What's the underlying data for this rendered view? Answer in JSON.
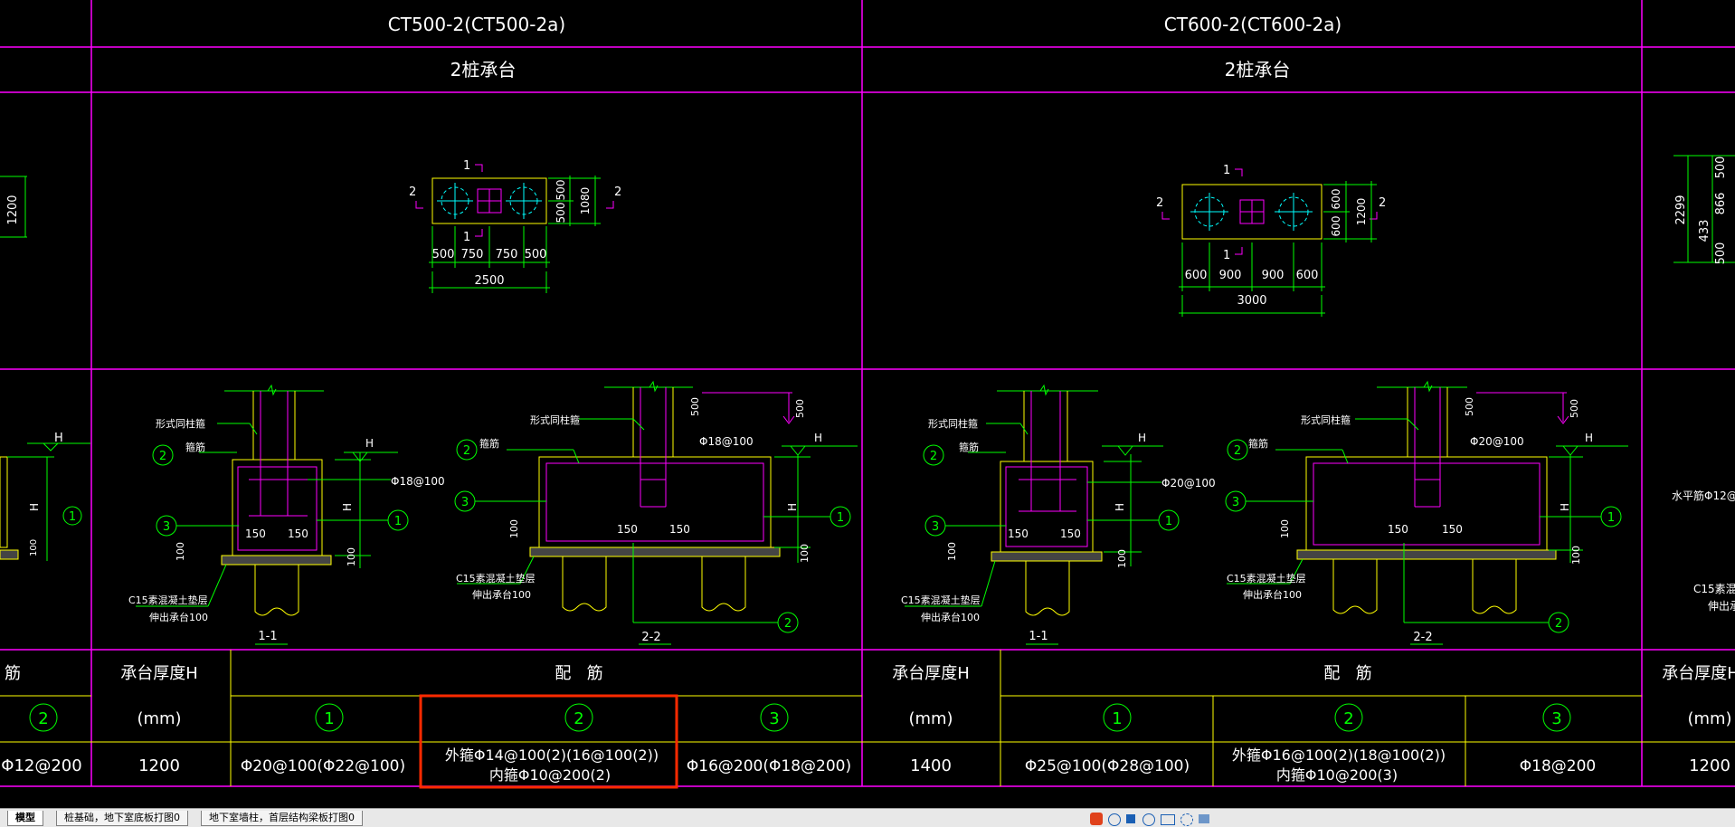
{
  "titles": {
    "left": "CT500-2(CT500-2a)",
    "right": "CT600-2(CT600-2a)",
    "left_sub": "2桩承台",
    "right_sub": "2桩承台"
  },
  "plan_left": {
    "dims_bottom": [
      "500",
      "750",
      "750",
      "500"
    ],
    "total": "2500",
    "dims_right": [
      "500",
      "500"
    ],
    "total_right": "1080",
    "sec1_top": "1",
    "sec1_bot": "1",
    "sec2_left": "2",
    "sec2_right": "2"
  },
  "plan_right": {
    "dims_bottom": [
      "600",
      "900",
      "900",
      "600"
    ],
    "total": "3000",
    "dims_right": [
      "600",
      "600"
    ],
    "total_right": "1200",
    "sec1_top": "1",
    "sec1_bot": "1",
    "sec2_left": "2",
    "sec2_right": "2"
  },
  "far_left": {
    "dim": "1200",
    "H": "H",
    "dim2": "100",
    "circle": "1"
  },
  "far_right": {
    "dim_a": "2299",
    "dim_b": "433",
    "dim_c": "500",
    "dim_d": "866",
    "dim_e": "500",
    "note1": "水平筋Φ12@",
    "note2": "C15素混凝",
    "note3": "伸出承"
  },
  "sections_left": {
    "s11": {
      "col_label": "形式同柱箍",
      "stir_label": "箍筋",
      "rebar": "Φ18@100",
      "H": "H",
      "d150a": "150",
      "d150b": "150",
      "d100a": "100",
      "d100b": "100",
      "c15": "C15素混凝土垫层",
      "ext": "伸出承台100",
      "name": "1-1",
      "c2": "2",
      "c3": "3",
      "c1": "1"
    },
    "s22": {
      "col_label": "形式同柱箍",
      "stir_label": "箍筋",
      "rebar": "Φ18@100",
      "H": "H",
      "d500a": "500",
      "d500b": "500",
      "d150a": "150",
      "d150b": "150",
      "d100a": "100",
      "d100b": "100",
      "c15": "C15素混凝土垫层",
      "ext": "伸出承台100",
      "name": "2-2",
      "c2": "2",
      "c3": "3",
      "c1": "1",
      "c2b": "2"
    }
  },
  "sections_right": {
    "s11": {
      "col_label": "形式同柱箍",
      "stir_label": "箍筋",
      "rebar": "Φ20@100",
      "H": "H",
      "d150a": "150",
      "d150b": "150",
      "d100a": "100",
      "d100b": "100",
      "c15": "C15素混凝土垫层",
      "ext": "伸出承台100",
      "name": "1-1",
      "c2": "2",
      "c3": "3",
      "c1": "1"
    },
    "s22": {
      "col_label": "形式同柱箍",
      "stir_label": "箍筋",
      "rebar": "Φ20@100",
      "H": "H",
      "d500a": "500",
      "d500b": "500",
      "d150a": "150",
      "d150b": "150",
      "d100a": "100",
      "d100b": "100",
      "c15": "C15素混凝土垫层",
      "ext": "伸出承台100",
      "name": "2-2",
      "c2": "2",
      "c3": "3",
      "c1": "1",
      "c2b": "2"
    }
  },
  "table": {
    "far_left_header": "筋",
    "far_left_circle": "2",
    "far_left_value": "Φ12@200",
    "left": {
      "thickness_label": "承台厚度H",
      "unit": "(mm)",
      "thickness": "1200",
      "rebar_header": "配   筋",
      "c1": "1",
      "c2": "2",
      "c3": "3",
      "v1": "Φ20@100(Φ22@100)",
      "v2_line1": "外箍Φ14@100(2)(16@100(2))",
      "v2_line2": "内箍Φ10@200(2)",
      "v3": "Φ16@200(Φ18@200)"
    },
    "right": {
      "thickness_label": "承台厚度H",
      "unit": "(mm)",
      "thickness": "1400",
      "rebar_header": "配   筋",
      "c1": "1",
      "c2": "2",
      "c3": "3",
      "v1": "Φ25@100(Φ28@100)",
      "v2_line1": "外箍Φ16@100(2)(18@100(2))",
      "v2_line2": "内箍Φ10@200(3)",
      "v3": "Φ18@200"
    },
    "far_right": {
      "thickness_label": "承台厚度H",
      "unit": "(mm)",
      "thickness": "1200"
    }
  },
  "tabs": [
    "模型",
    "桩基础，地下室底板打图0",
    "地下室墙柱，首层结构梁板打图0"
  ],
  "colors": {
    "yellow": "#ffff00",
    "magenta": "#ff00ff",
    "green": "#00ff00",
    "white": "#ffffff",
    "cyan": "#00ffff",
    "red": "#ff3300",
    "highlight": "#ff2a00"
  }
}
